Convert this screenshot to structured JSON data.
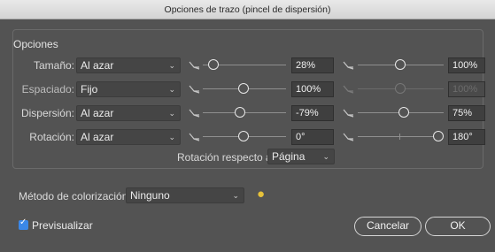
{
  "window": {
    "title": "Opciones de trazo (pincel de dispersión)"
  },
  "options": {
    "group_label": "Opciones",
    "rows": [
      {
        "label": "Tamaño:",
        "select": "Al azar",
        "value1": "28%",
        "value2": "100%"
      },
      {
        "label": "Espaciado:",
        "select": "Fijo",
        "value1": "100%",
        "value2": "100%"
      },
      {
        "label": "Dispersión:",
        "select": "Al azar",
        "value1": "-79%",
        "value2": "75%"
      },
      {
        "label": "Rotación:",
        "select": "Al azar",
        "value1": "0°",
        "value2": "180°"
      }
    ],
    "rotation_relative": {
      "label": "Rotación respecto a:",
      "value": "Página"
    }
  },
  "colorization": {
    "label": "Método de colorización:",
    "value": "Ninguno"
  },
  "preview": {
    "label": "Previsualizar",
    "checked": true
  },
  "buttons": {
    "cancel": "Cancelar",
    "ok": "OK"
  },
  "icons": {
    "chevron": "chevron-down-icon",
    "pressure": "pen-pressure-icon",
    "tip": "lightbulb-icon",
    "check": "checkmark-icon"
  },
  "colors": {
    "background": "#535353",
    "accent": "#3b88e8",
    "tip": "#e6c13a"
  }
}
